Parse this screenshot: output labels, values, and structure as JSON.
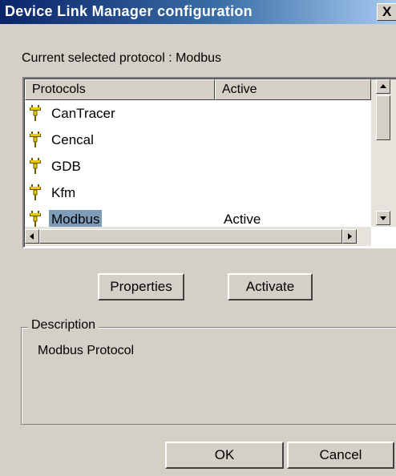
{
  "window": {
    "title": "Device Link Manager configuration",
    "close_label": "X"
  },
  "current_protocol": {
    "label": "Current selected protocol : Modbus"
  },
  "protocol_list": {
    "columns": [
      "Protocols",
      "Active"
    ],
    "rows": [
      {
        "name": "CanTracer",
        "active": "",
        "icon": "plug-icon",
        "selected": false
      },
      {
        "name": "Cencal",
        "active": "",
        "icon": "plug-icon",
        "selected": false
      },
      {
        "name": "GDB",
        "active": "",
        "icon": "plug-icon",
        "selected": false
      },
      {
        "name": "Kfm",
        "active": "",
        "icon": "plug-icon",
        "selected": false
      },
      {
        "name": "Modbus",
        "active": "Active",
        "icon": "plug-icon",
        "selected": true
      }
    ]
  },
  "buttons": {
    "properties": "Properties",
    "activate": "Activate",
    "ok": "OK",
    "cancel": "Cancel"
  },
  "description": {
    "legend": "Description",
    "text": "Modbus Protocol"
  },
  "colors": {
    "title_start": "#0a246a",
    "title_end": "#a6caf0",
    "face": "#d4d0c8",
    "selection": "#7f9db9"
  }
}
